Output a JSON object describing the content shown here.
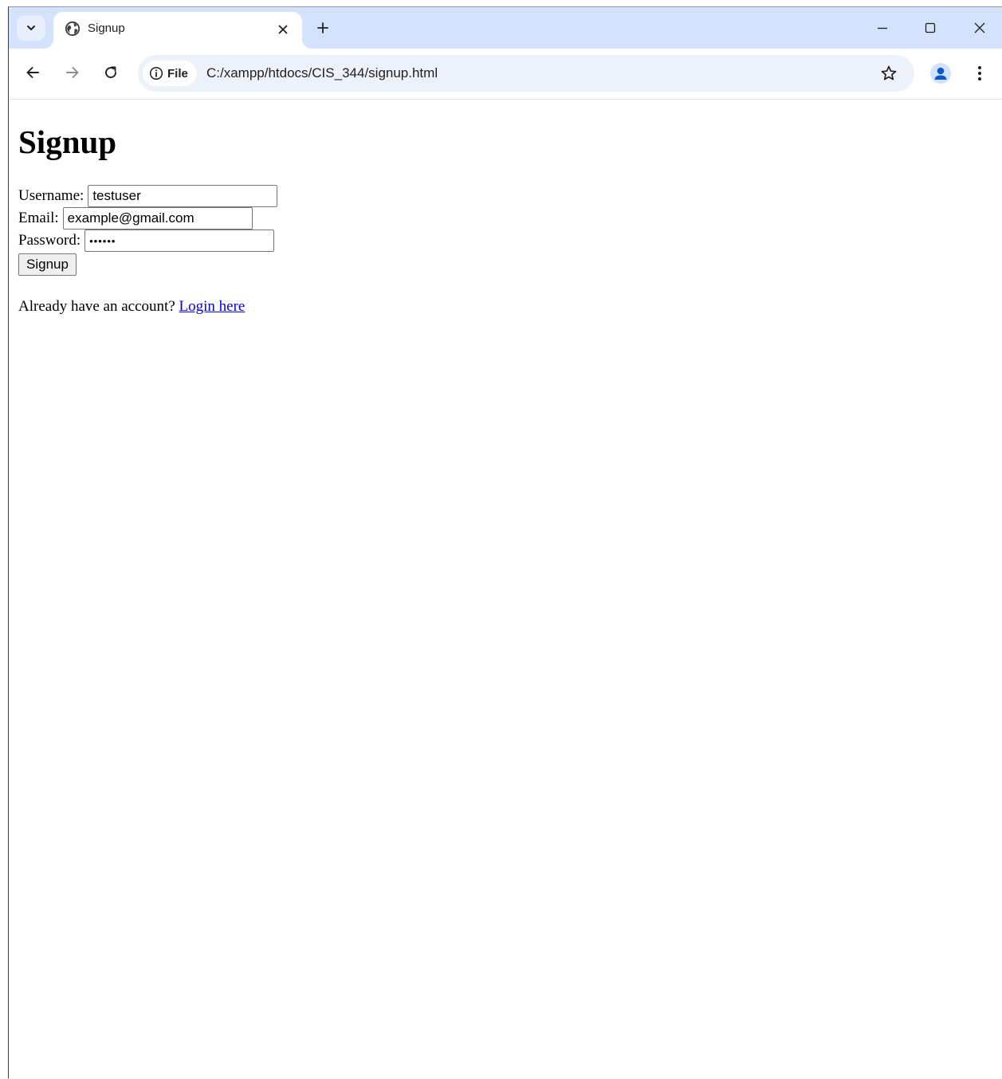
{
  "browser": {
    "tab_title": "Signup",
    "site_chip_label": "File",
    "url": "C:/xampp/htdocs/CIS_344/signup.html",
    "icons": {
      "tab_search": "chevron-down-icon",
      "favicon": "globe-icon",
      "tab_close": "close-icon",
      "new_tab": "plus-icon",
      "minimize": "minimize-icon",
      "maximize": "maximize-icon",
      "window_close": "close-icon",
      "back": "arrow-left-icon",
      "forward": "arrow-right-icon",
      "reload": "reload-icon",
      "site_info": "info-icon",
      "bookmark": "star-icon",
      "profile": "person-icon",
      "menu": "kebab-menu-icon"
    }
  },
  "page": {
    "title": "Signup",
    "form": {
      "username_label": "Username:",
      "username_value": "testuser",
      "email_label": "Email:",
      "email_value": "example@gmail.com",
      "password_label": "Password:",
      "password_value": "••••••",
      "submit_label": "Signup"
    },
    "login_prompt": "Already have an account?",
    "login_link": "Login here",
    "colors": {
      "link": "#0000ee",
      "tabstrip": "#d3e3fd",
      "omnibox": "#edf2fa"
    }
  }
}
